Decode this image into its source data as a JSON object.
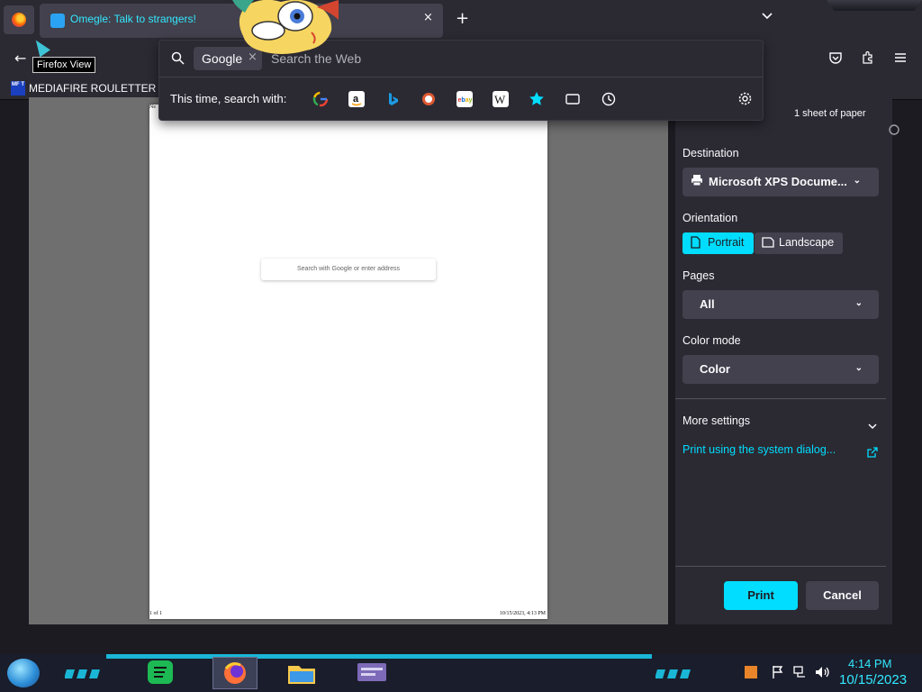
{
  "browser": {
    "tab": {
      "title": "Omegle: Talk to strangers!",
      "close_icon": "×"
    },
    "new_tab_icon": "+",
    "tab_list_icon": "chevron-down",
    "tooltip": "Firefox View",
    "bookmark": {
      "icon_text": "MF T",
      "label": "MEDIAFIRE ROULETTER"
    }
  },
  "urlbar": {
    "engine_chip": "Google",
    "chip_close": "×",
    "placeholder": "Search the Web",
    "search_with_label": "This time, search with:",
    "engines": [
      "google-icon",
      "amazon-icon",
      "bing-icon",
      "duckduckgo-icon",
      "ebay-icon",
      "wikipedia-icon",
      "bookmarks-icon",
      "tabs-icon",
      "history-icon"
    ]
  },
  "preview": {
    "search_placeholder": "Search with Google or enter address",
    "footer_left": "1 of 1",
    "footer_right": "10/15/2023, 4:13 PM",
    "header_left": "Ne"
  },
  "print": {
    "sheet_count": "1 sheet of paper",
    "destination_label": "Destination",
    "destination_value": "Microsoft XPS Docume...",
    "orientation_label": "Orientation",
    "portrait": "Portrait",
    "landscape": "Landscape",
    "pages_label": "Pages",
    "pages_value": "All",
    "color_label": "Color mode",
    "color_value": "Color",
    "more_settings": "More settings",
    "system_dialog": "Print using the system dialog...",
    "print_button": "Print",
    "cancel_button": "Cancel"
  },
  "taskbar": {
    "time": "4:14 PM",
    "date": "10/15/2023"
  },
  "colors": {
    "accent": "#00ddff",
    "panel": "#2b2a33",
    "field": "#42414d"
  }
}
